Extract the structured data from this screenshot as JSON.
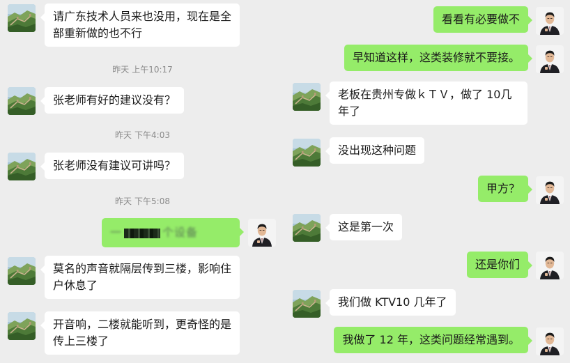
{
  "left_chat": {
    "messages": [
      {
        "sender": "other",
        "text": "请广东技术人员来也没用，现在是全部重新做的也不行"
      },
      {
        "time_day": "昨天",
        "time_clock": "上午10:17"
      },
      {
        "sender": "other",
        "text": "张老师有好的建议没有？"
      },
      {
        "time_day": "昨天",
        "time_clock": "下午4:03"
      },
      {
        "sender": "other",
        "text": "张老师没有建议可讲吗？"
      },
      {
        "time_day": "昨天",
        "time_clock": "下午5:08"
      },
      {
        "sender": "me",
        "text": "(redacted)",
        "redacted_fragments": [
          "一",
          "个",
          "设备"
        ]
      },
      {
        "sender": "other",
        "text": "莫名的声音就隔层传到三楼，影响住户休息了"
      },
      {
        "sender": "other",
        "text": "开音响，二楼就能听到，更奇怪的是传上三楼了"
      }
    ]
  },
  "right_chat": {
    "messages": [
      {
        "sender": "me",
        "text": "看看有必要做不"
      },
      {
        "sender": "me",
        "text": "早知道这样，这类装修就不要接。"
      },
      {
        "sender": "other",
        "text": "老板在贵州专做ｋＴＶ，做了 10几年了"
      },
      {
        "sender": "other",
        "text": "没出现这种问题"
      },
      {
        "sender": "me",
        "text": "甲方？"
      },
      {
        "sender": "other",
        "text": "这是第一次"
      },
      {
        "sender": "me",
        "text": "还是你们"
      },
      {
        "sender": "other",
        "text": "我们做 KTV10 几年了"
      },
      {
        "sender": "me",
        "text": "我做了 12 年，这类问题经常遇到。"
      }
    ]
  },
  "colors": {
    "background": "#ededed",
    "incoming_bubble": "#ffffff",
    "outgoing_bubble": "#95ec69",
    "timestamp_text": "#8a8a8a"
  },
  "icons": {
    "other_avatar": "great-wall-landscape-avatar",
    "my_avatar": "man-in-suit-avatar"
  }
}
